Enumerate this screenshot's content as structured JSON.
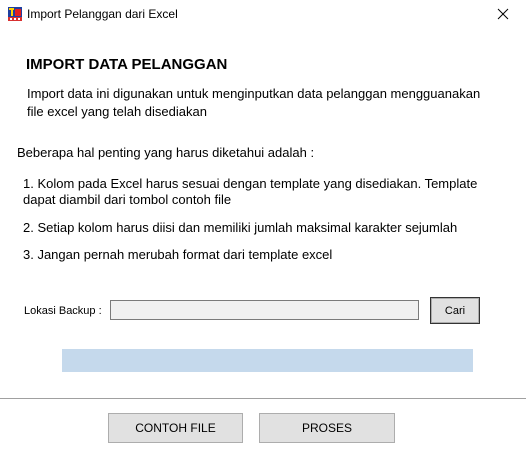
{
  "window": {
    "title": "Import Pelanggan dari Excel"
  },
  "content": {
    "heading": "IMPORT DATA PELANGGAN",
    "description": "Import data ini digunakan untuk menginputkan data pelanggan mengguanakan file excel yang telah disediakan",
    "intro": "Beberapa hal penting yang harus diketahui adalah :",
    "rules": [
      "1. Kolom pada Excel harus sesuai dengan template yang disediakan. Template dapat diambil dari tombol contoh file",
      "2. Setiap kolom harus diisi dan memiliki jumlah maksimal karakter sejumlah",
      "3. Jangan pernah merubah format dari template excel"
    ]
  },
  "backup": {
    "label": "Lokasi Backup :",
    "value": "",
    "browse_label": "Cari"
  },
  "progress": {
    "value": 0
  },
  "footer": {
    "contoh_label": "CONTOH FILE",
    "proses_label": "PROSES"
  },
  "colors": {
    "progress_track": "#c5d9ec",
    "button_face": "#e1e1e1",
    "input_background": "#f0f0f0"
  },
  "icons": {
    "app": "app-pos-icon",
    "close": "close-icon"
  }
}
